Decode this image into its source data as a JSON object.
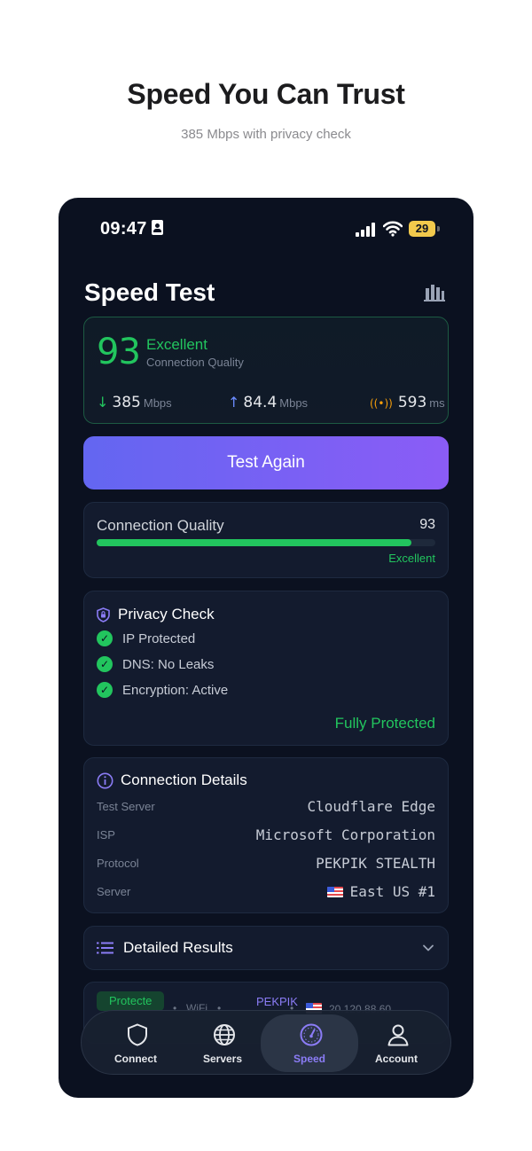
{
  "hero": {
    "title": "Speed You Can Trust",
    "subtitle": "385 Mbps with privacy check"
  },
  "status_bar": {
    "time": "09:47",
    "battery": "29"
  },
  "screen": {
    "title": "Speed Test",
    "chart_icon": "bar-chart-icon"
  },
  "score": {
    "value": "93",
    "label": "Excellent",
    "sub": "Connection Quality",
    "download": {
      "value": "385",
      "unit": "Mbps"
    },
    "upload": {
      "value": "84.4",
      "unit": "Mbps"
    },
    "ping": {
      "value": "593",
      "unit": "ms"
    }
  },
  "test_button": {
    "label": "Test Again"
  },
  "quality": {
    "label": "Connection Quality",
    "value": "93",
    "fill_percent": 93,
    "status": "Excellent"
  },
  "privacy": {
    "title": "Privacy Check",
    "items": [
      "IP Protected",
      "DNS: No Leaks",
      "Encryption: Active"
    ],
    "status": "Fully Protected"
  },
  "details": {
    "title": "Connection Details",
    "rows": [
      {
        "key": "Test Server",
        "value": "Cloudflare Edge"
      },
      {
        "key": "ISP",
        "value": "Microsoft Corporation"
      },
      {
        "key": "Protocol",
        "value": "PEKPIK STEALTH"
      },
      {
        "key": "Server",
        "value": "East US #1"
      }
    ]
  },
  "results": {
    "title": "Detailed Results"
  },
  "info_strip": {
    "badge": "Protecte",
    "network": "WiFi",
    "protocol": "PEKPIK",
    "ip": "20.120.88.60"
  },
  "nav": {
    "items": [
      {
        "label": "Connect",
        "icon": "shield-icon"
      },
      {
        "label": "Servers",
        "icon": "globe-icon"
      },
      {
        "label": "Speed",
        "icon": "speedometer-icon"
      },
      {
        "label": "Account",
        "icon": "user-icon"
      }
    ],
    "active": "Speed"
  },
  "colors": {
    "background": "#0b1120",
    "card": "#131b2e",
    "success": "#22c55e",
    "accent": "#8b5cf6",
    "ping": "#f59e0b"
  }
}
